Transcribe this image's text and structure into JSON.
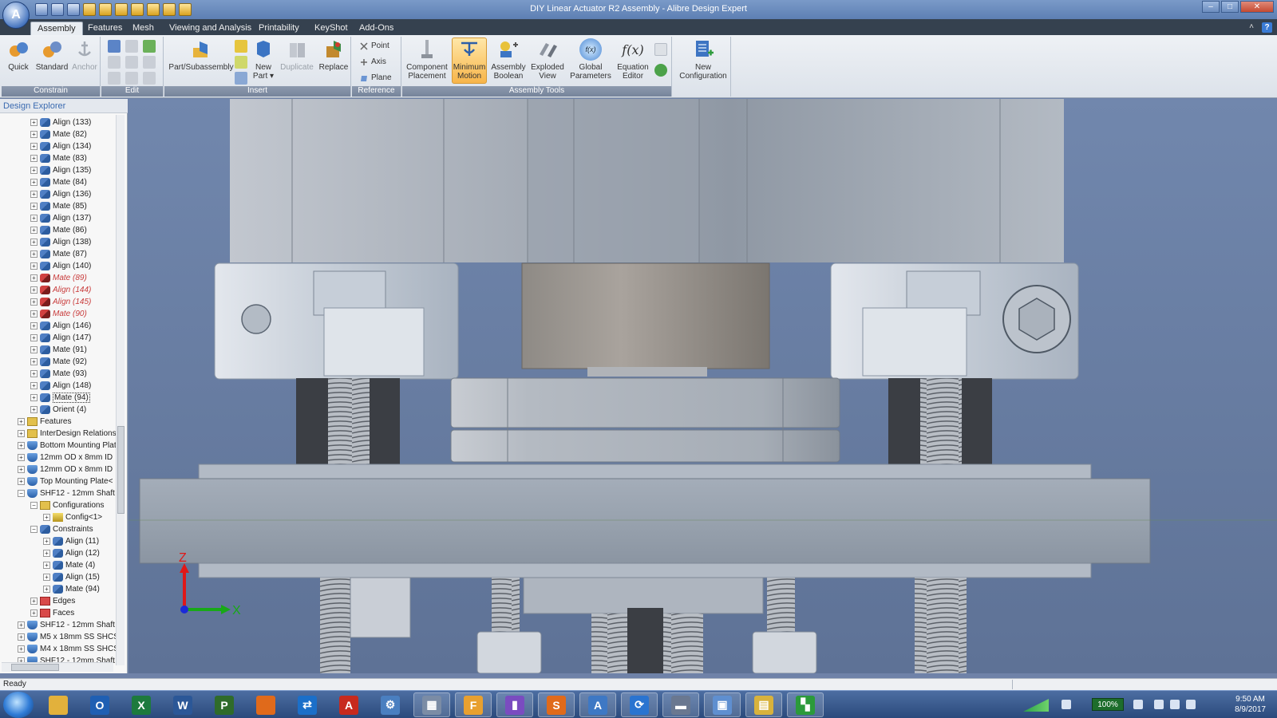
{
  "window": {
    "title": "DIY Linear Actuator R2 Assembly - Alibre Design Expert",
    "app_orb_glyph": "A",
    "controls": [
      "–",
      "□",
      "✕"
    ]
  },
  "ribbon_tabs": [
    "Assembly",
    "Features",
    "Mesh",
    "Viewing and Analysis",
    "Printability",
    "KeyShot",
    "Add-Ons"
  ],
  "ribbon_right": {
    "collapse": "˄",
    "help": "?"
  },
  "ribbon": {
    "constrain": {
      "label": "Constrain",
      "quick": "Quick",
      "standard": "Standard",
      "anchor": "Anchor"
    },
    "edit": {
      "label": "Edit"
    },
    "insert": {
      "label": "Insert",
      "part_subassembly": "Part/Subassembly",
      "new_part": "New",
      "new_part_2": "Part ▾",
      "duplicate": "Duplicate",
      "replace": "Replace"
    },
    "reference": {
      "label": "Reference",
      "point": "Point",
      "axis": "Axis",
      "plane": "Plane"
    },
    "assembly_tools": {
      "label": "Assembly Tools",
      "component_placement": [
        "Component",
        "Placement"
      ],
      "minimum_motion": [
        "Minimum",
        "Motion"
      ],
      "assembly_boolean": [
        "Assembly",
        "Boolean"
      ],
      "exploded_view": [
        "Exploded",
        "View"
      ],
      "global_parameters": [
        "Global",
        "Parameters"
      ],
      "equation_editor": [
        "Equation",
        "Editor"
      ],
      "equation_glyph": "f(x)",
      "global_glyph": "f(x)"
    },
    "config": {
      "new_configuration": [
        "New",
        "Configuration"
      ]
    }
  },
  "explorer": {
    "title": "Design Explorer",
    "items": [
      {
        "label": "Align (133)",
        "indent": 1,
        "icon": "constraint",
        "state": "normal"
      },
      {
        "label": "Mate (82)",
        "indent": 1,
        "icon": "constraint",
        "state": "normal"
      },
      {
        "label": "Align (134)",
        "indent": 1,
        "icon": "constraint",
        "state": "normal"
      },
      {
        "label": "Mate (83)",
        "indent": 1,
        "icon": "constraint",
        "state": "normal"
      },
      {
        "label": "Align (135)",
        "indent": 1,
        "icon": "constraint",
        "state": "normal"
      },
      {
        "label": "Mate (84)",
        "indent": 1,
        "icon": "constraint",
        "state": "normal"
      },
      {
        "label": "Align (136)",
        "indent": 1,
        "icon": "constraint",
        "state": "normal"
      },
      {
        "label": "Mate (85)",
        "indent": 1,
        "icon": "constraint",
        "state": "normal"
      },
      {
        "label": "Align (137)",
        "indent": 1,
        "icon": "constraint",
        "state": "normal"
      },
      {
        "label": "Mate (86)",
        "indent": 1,
        "icon": "constraint",
        "state": "normal"
      },
      {
        "label": "Align (138)",
        "indent": 1,
        "icon": "constraint",
        "state": "normal"
      },
      {
        "label": "Mate (87)",
        "indent": 1,
        "icon": "constraint",
        "state": "normal"
      },
      {
        "label": "Align (140)",
        "indent": 1,
        "icon": "constraint",
        "state": "normal"
      },
      {
        "label": "Mate (89)",
        "indent": 1,
        "icon": "constraint-err",
        "state": "error"
      },
      {
        "label": "Align (144)",
        "indent": 1,
        "icon": "constraint-err",
        "state": "error"
      },
      {
        "label": "Align (145)",
        "indent": 1,
        "icon": "constraint-err",
        "state": "error"
      },
      {
        "label": "Mate (90)",
        "indent": 1,
        "icon": "constraint-err",
        "state": "error"
      },
      {
        "label": "Align (146)",
        "indent": 1,
        "icon": "constraint",
        "state": "normal"
      },
      {
        "label": "Align (147)",
        "indent": 1,
        "icon": "constraint",
        "state": "normal"
      },
      {
        "label": "Mate (91)",
        "indent": 1,
        "icon": "constraint",
        "state": "normal"
      },
      {
        "label": "Mate (92)",
        "indent": 1,
        "icon": "constraint",
        "state": "normal"
      },
      {
        "label": "Mate (93)",
        "indent": 1,
        "icon": "constraint",
        "state": "normal"
      },
      {
        "label": "Align (148)",
        "indent": 1,
        "icon": "constraint",
        "state": "normal"
      },
      {
        "label": "Mate (94)",
        "indent": 1,
        "icon": "constraint",
        "state": "selected"
      },
      {
        "label": "Orient (4)",
        "indent": 1,
        "icon": "constraint",
        "state": "normal"
      },
      {
        "label": "Features",
        "indent": 0,
        "icon": "folder",
        "state": "normal"
      },
      {
        "label": "InterDesign Relations",
        "indent": 0,
        "icon": "folder",
        "state": "normal"
      },
      {
        "label": "Bottom Mounting Plat",
        "indent": 0,
        "icon": "part",
        "state": "normal"
      },
      {
        "label": "12mm OD x 8mm ID",
        "indent": 0,
        "icon": "part",
        "state": "normal"
      },
      {
        "label": "12mm OD x 8mm ID",
        "indent": 0,
        "icon": "part",
        "state": "normal"
      },
      {
        "label": "Top Mounting Plate<",
        "indent": 0,
        "icon": "part",
        "state": "normal"
      },
      {
        "label": "SHF12 - 12mm Shaft",
        "indent": 0,
        "icon": "part",
        "state": "normal"
      },
      {
        "label": "Configurations",
        "indent": 1,
        "icon": "folder",
        "state": "normal"
      },
      {
        "label": "Config<1>",
        "indent": 2,
        "icon": "config",
        "state": "normal"
      },
      {
        "label": "Constraints",
        "indent": 1,
        "icon": "constraint",
        "state": "normal"
      },
      {
        "label": "Align (11)",
        "indent": 2,
        "icon": "constraint",
        "state": "normal"
      },
      {
        "label": "Align (12)",
        "indent": 2,
        "icon": "constraint",
        "state": "normal"
      },
      {
        "label": "Mate (4)",
        "indent": 2,
        "icon": "constraint",
        "state": "normal"
      },
      {
        "label": "Align (15)",
        "indent": 2,
        "icon": "constraint",
        "state": "normal"
      },
      {
        "label": "Mate (94)",
        "indent": 2,
        "icon": "constraint",
        "state": "normal"
      },
      {
        "label": "Edges",
        "indent": 1,
        "icon": "edges",
        "state": "normal"
      },
      {
        "label": "Faces",
        "indent": 1,
        "icon": "edges",
        "state": "normal"
      },
      {
        "label": "SHF12 - 12mm Shaft",
        "indent": 0,
        "icon": "part",
        "state": "normal"
      },
      {
        "label": "M5 x 18mm SS SHCS",
        "indent": 0,
        "icon": "part",
        "state": "normal"
      },
      {
        "label": "M4 x 18mm SS SHCS",
        "indent": 0,
        "icon": "part",
        "state": "normal"
      },
      {
        "label": "SHF12 - 12mm Shaft",
        "indent": 0,
        "icon": "part",
        "state": "normal"
      }
    ]
  },
  "axis_triad": {
    "z": "Z",
    "x": "X"
  },
  "status": {
    "text": "Ready"
  },
  "taskbar": {
    "apps": [
      {
        "name": "explorer",
        "glyph": "",
        "color": "#e2b13c"
      },
      {
        "name": "outlook",
        "glyph": "O",
        "color": "#1f5fb3"
      },
      {
        "name": "excel",
        "glyph": "X",
        "color": "#1d7a3d"
      },
      {
        "name": "word",
        "glyph": "W",
        "color": "#2b5797"
      },
      {
        "name": "project",
        "glyph": "P",
        "color": "#2f6b2a"
      },
      {
        "name": "firefox",
        "glyph": "",
        "color": "#e06a1b"
      },
      {
        "name": "teamviewer",
        "glyph": "⇄",
        "color": "#1b6fc9"
      },
      {
        "name": "acrobat",
        "glyph": "A",
        "color": "#c72a1e"
      },
      {
        "name": "settings",
        "glyph": "⚙",
        "color": "#4a7fc0"
      },
      {
        "name": "calculator",
        "glyph": "▦",
        "color": "#7b8ca5"
      },
      {
        "name": "fusion",
        "glyph": "F",
        "color": "#e8a030"
      },
      {
        "name": "chart-app",
        "glyph": "▮",
        "color": "#7a4cc0"
      },
      {
        "name": "slicer",
        "glyph": "S",
        "color": "#e06a1b"
      },
      {
        "name": "alibre",
        "glyph": "A",
        "color": "#3e78c4"
      },
      {
        "name": "sync",
        "glyph": "⟳",
        "color": "#2a74d0"
      },
      {
        "name": "tool",
        "glyph": "▬",
        "color": "#6a7890"
      },
      {
        "name": "remote",
        "glyph": "▣",
        "color": "#5f8fd0"
      },
      {
        "name": "folder2",
        "glyph": "▤",
        "color": "#d8b23c"
      },
      {
        "name": "terminal",
        "glyph": "▚",
        "color": "#2b9a3a"
      }
    ],
    "tray": {
      "zoom": "100%",
      "time": "9:50 AM",
      "date": "8/9/2017"
    }
  }
}
